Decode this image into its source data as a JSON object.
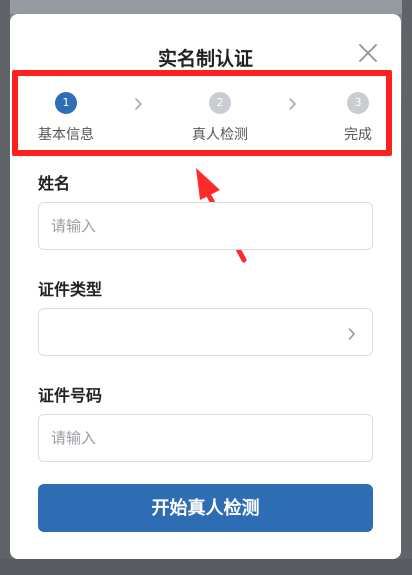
{
  "dialog": {
    "title": "实名制认证"
  },
  "steps": [
    {
      "number": "1",
      "label": "基本信息",
      "state": "active"
    },
    {
      "number": "2",
      "label": "真人检测",
      "state": "pending"
    },
    {
      "number": "3",
      "label": "完成",
      "state": "pending"
    }
  ],
  "form": {
    "name": {
      "label": "姓名",
      "placeholder": "请输入",
      "value": ""
    },
    "id_type": {
      "label": "证件类型",
      "value": ""
    },
    "id_number": {
      "label": "证件号码",
      "placeholder": "请输入",
      "value": ""
    }
  },
  "actions": {
    "start_label": "开始真人检测"
  },
  "colors": {
    "accent": "#2e6cb3",
    "highlight": "#ff1f1f",
    "step_idle": "#c9ccd0"
  },
  "icons": {
    "close": "close-icon",
    "step_arrow": "chevron-right-icon",
    "select_arrow": "chevron-right-icon",
    "annotation": "arrow-up-left-icon"
  }
}
